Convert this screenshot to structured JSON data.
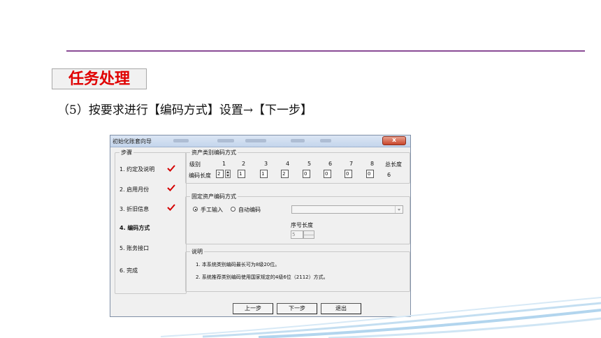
{
  "slide": {
    "section_tag": "任务处理",
    "instruction": "（5）按要求进行【编码方式】设置→【下一步】"
  },
  "dialog": {
    "title": "初始化账套向导",
    "close_label": "x",
    "steps_legend": "步骤",
    "steps": [
      {
        "label": "1. 约定及说明",
        "done": true
      },
      {
        "label": "2. 启用月份",
        "done": true
      },
      {
        "label": "3. 折旧信息",
        "done": true
      },
      {
        "label": "4. 编码方式",
        "active": true
      },
      {
        "label": "5. 账务接口"
      },
      {
        "label": "6. 完成"
      }
    ],
    "asset_encoding": {
      "legend": "资产类别编码方式",
      "level_label": "级别",
      "length_label": "编码长度",
      "total_label": "总长度",
      "levels": [
        "1",
        "2",
        "3",
        "4",
        "5",
        "6",
        "7",
        "8"
      ],
      "lengths": [
        "2",
        "1",
        "1",
        "2",
        "0",
        "0",
        "0",
        "0"
      ],
      "total": "6"
    },
    "fixed_asset_encoding": {
      "legend": "固定资产编码方式",
      "manual_label": "手工输入",
      "auto_label": "自动编码",
      "selected": "manual",
      "combo_value": "",
      "seq_length_label": "序号长度",
      "seq_length_value": "5"
    },
    "notes": {
      "legend": "说明",
      "line1": "1. 本系统类别编码最长可为8级20位。",
      "line2": "2. 系统推荐类别编码使用国家规定的4级6位（2112）方式。"
    },
    "buttons": {
      "prev": "上一步",
      "next": "下一步",
      "exit": "退出"
    },
    "check_color": "#d40000"
  }
}
